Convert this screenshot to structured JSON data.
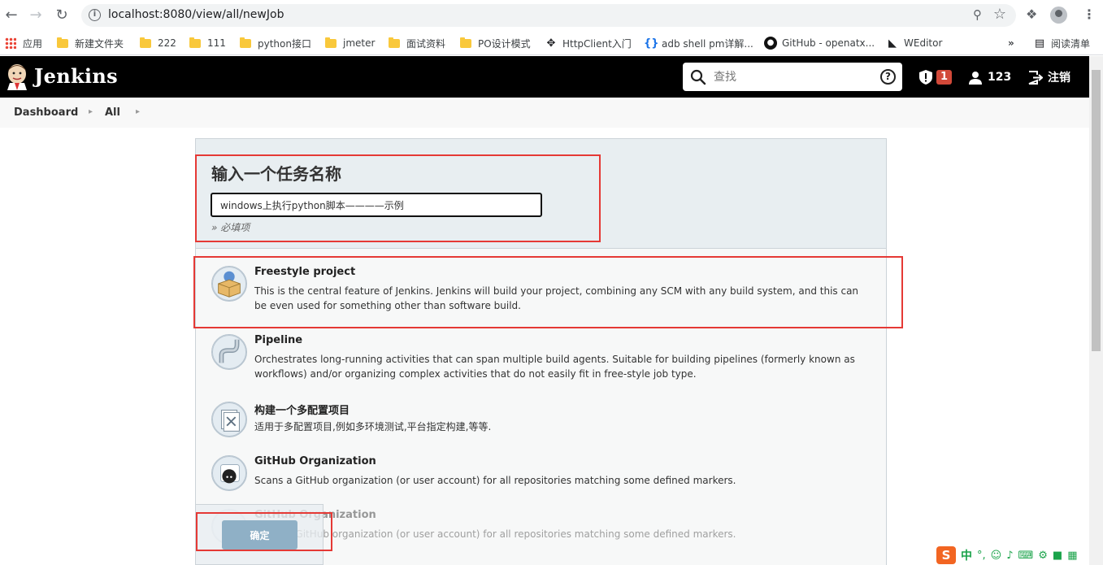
{
  "browser": {
    "url": "localhost:8080/view/all/newJob",
    "bookmarks": [
      {
        "label": "应用",
        "icon": "apps-grid-icon"
      },
      {
        "label": "新建文件夹",
        "icon": "folder-icon"
      },
      {
        "label": "222",
        "icon": "folder-icon"
      },
      {
        "label": "111",
        "icon": "folder-icon"
      },
      {
        "label": "python接口",
        "icon": "folder-icon"
      },
      {
        "label": "jmeter",
        "icon": "folder-icon"
      },
      {
        "label": "面试资料",
        "icon": "folder-icon"
      },
      {
        "label": "PO设计模式",
        "icon": "folder-icon"
      },
      {
        "label": "HttpClient入门",
        "icon": "link-icon"
      },
      {
        "label": "adb shell pm详解...",
        "icon": "curly-braces-icon"
      },
      {
        "label": "GitHub - openatx...",
        "icon": "github-icon"
      },
      {
        "label": "WEditor",
        "icon": "weditor-icon"
      }
    ],
    "more_label": "»",
    "reading_list": "阅读清单"
  },
  "header": {
    "app_name": "Jenkins",
    "search_placeholder": "查找",
    "alerts_count": "1",
    "user": "123",
    "logout": "注销"
  },
  "breadcrumbs": [
    "Dashboard",
    "All"
  ],
  "form": {
    "heading": "输入一个任务名称",
    "job_name": "windows上执行python脚本————示例",
    "required_hint": "» 必填项"
  },
  "job_types": [
    {
      "title": "Freestyle project",
      "description": "This is the central feature of Jenkins. Jenkins will build your project, combining any SCM with any build system, and this can be even used for something other than software build.",
      "icon": "freestyle-box-icon"
    },
    {
      "title": "Pipeline",
      "description": "Orchestrates long-running activities that can span multiple build agents. Suitable for building pipelines (formerly known as workflows) and/or organizing complex activities that do not easily fit in free-style job type.",
      "icon": "pipeline-icon"
    },
    {
      "title": "构建一个多配置项目",
      "description": "适用于多配置项目,例如多环境测试,平台指定构建,等等.",
      "icon": "multi-config-icon"
    },
    {
      "title": "GitHub Organization",
      "description": "Scans a GitHub organization (or user account) for all repositories matching some defined markers.",
      "icon": "github-org-icon"
    },
    {
      "title": "GitHub Organization",
      "description": "Scans a GitHub organization (or user account) for all repositories matching some defined markers.",
      "icon": "github-org-icon"
    }
  ],
  "ok_button": "确定",
  "ime": {
    "lang": "中",
    "punct": "°,"
  }
}
